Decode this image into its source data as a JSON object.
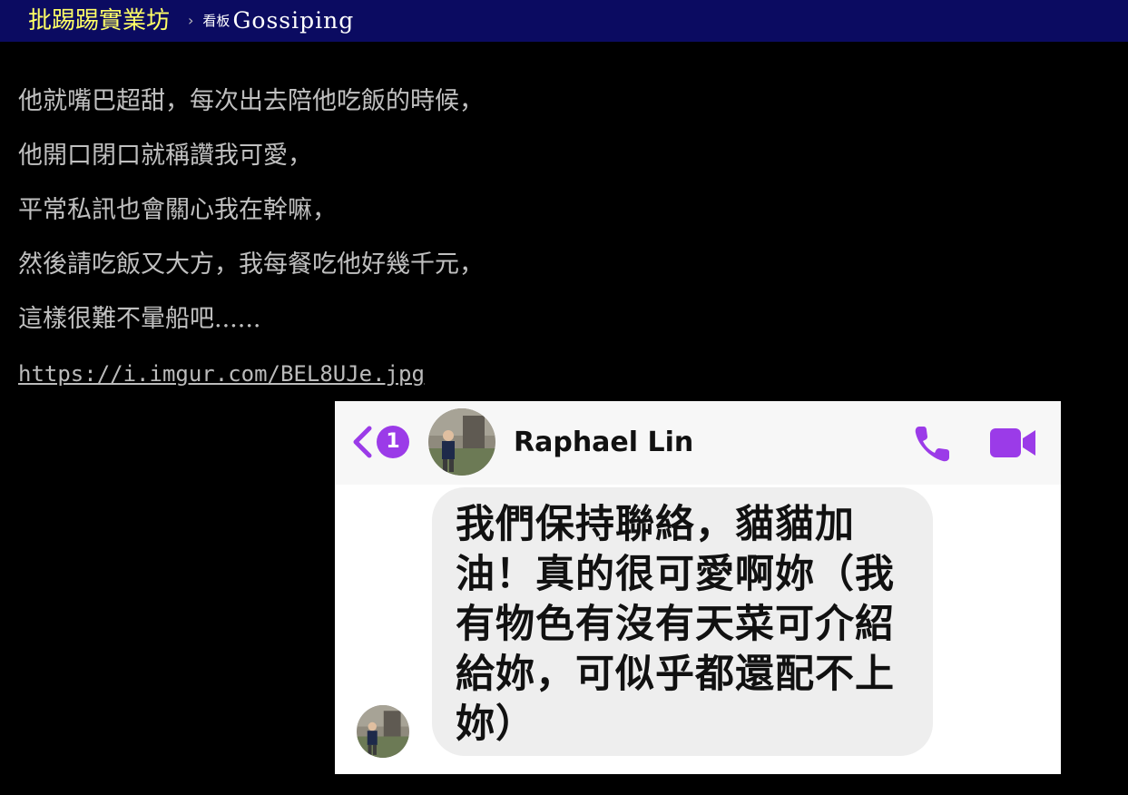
{
  "header": {
    "site_name": "批踢踢實業坊",
    "separator": "›",
    "board_prefix": "看板",
    "board_name": "Gossiping"
  },
  "post": {
    "lines": [
      "他就嘴巴超甜，每次出去陪他吃飯的時候，",
      "他開口閉口就稱讚我可愛，",
      "平常私訊也會關心我在幹嘛，",
      "然後請吃飯又大方，我每餐吃他好幾千元，",
      "這樣很難不暈船吧......"
    ],
    "link": "https://i.imgur.com/BEL8UJe.jpg"
  },
  "embedded_image": {
    "back_badge_count": "1",
    "contact_name": "Raphael Lin",
    "message_lines": [
      "我們保持聯絡，貓貓加",
      "油！真的很可愛啊妳（我",
      "有物色有沒有天菜可介紹",
      "給妳，可似乎都還配不上",
      "妳）"
    ],
    "icons": [
      "back-chevron-icon",
      "phone-icon",
      "video-camera-icon"
    ],
    "accent_color": "#9b3be8"
  },
  "colors": {
    "topbar_bg": "#0b0b61",
    "site_name": "#ffff66",
    "text": "#c0c0c0",
    "page_bg": "#000000"
  }
}
